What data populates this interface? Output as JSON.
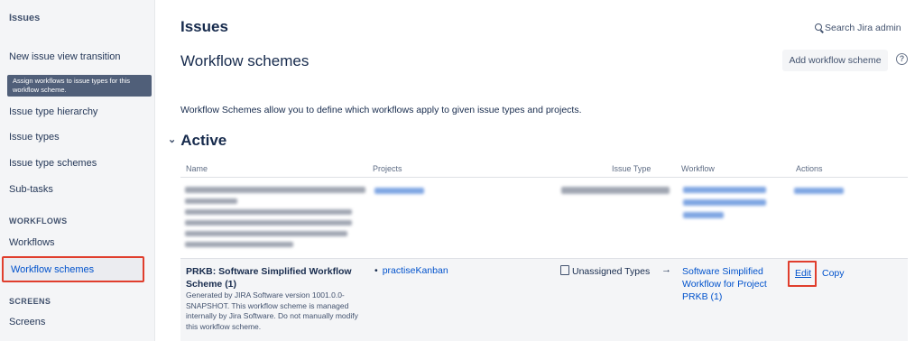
{
  "sidebar": {
    "title": "Issues",
    "items_top": [
      "New issue view transition",
      "Issue type hierarchy",
      "Issue types",
      "Issue type schemes",
      "Sub-tasks"
    ],
    "tooltip": "Assign workflows to issue types for this workflow scheme.",
    "workflows_heading": "WORKFLOWS",
    "workflows_items": [
      "Workflows",
      "Workflow schemes"
    ],
    "screens_heading": "SCREENS",
    "screens_items": [
      "Screens"
    ]
  },
  "header": {
    "title": "Issues",
    "search_label": "Search Jira admin",
    "subtitle": "Workflow schemes",
    "add_button": "Add workflow scheme",
    "help_glyph": "?"
  },
  "description": "Workflow Schemes allow you to define which workflows apply to given issue types and projects.",
  "section": {
    "chevron": "⌄",
    "title": "Active"
  },
  "table": {
    "columns": [
      "Name",
      "Projects",
      "Issue Type",
      "Workflow",
      "Actions"
    ],
    "row": {
      "name": "PRKB: Software Simplified Workflow Scheme (1)",
      "description": "Generated by JIRA Software version 1001.0.0-SNAPSHOT. This workflow scheme is managed internally by Jira Software. Do not manually modify this workflow scheme.",
      "project_bullet": "•",
      "project": "practiseKanban",
      "issue_type": "Unassigned Types",
      "arrow": "→",
      "workflow": "Software Simplified Workflow for Project PRKB (1)",
      "edit": "Edit",
      "copy": "Copy"
    }
  },
  "icons": {
    "search": "search-icon",
    "help": "help-icon",
    "document": "document-icon"
  },
  "colors": {
    "link": "#0052cc",
    "highlight": "#e03e2d",
    "sidebar_bg": "#f4f5f7"
  }
}
